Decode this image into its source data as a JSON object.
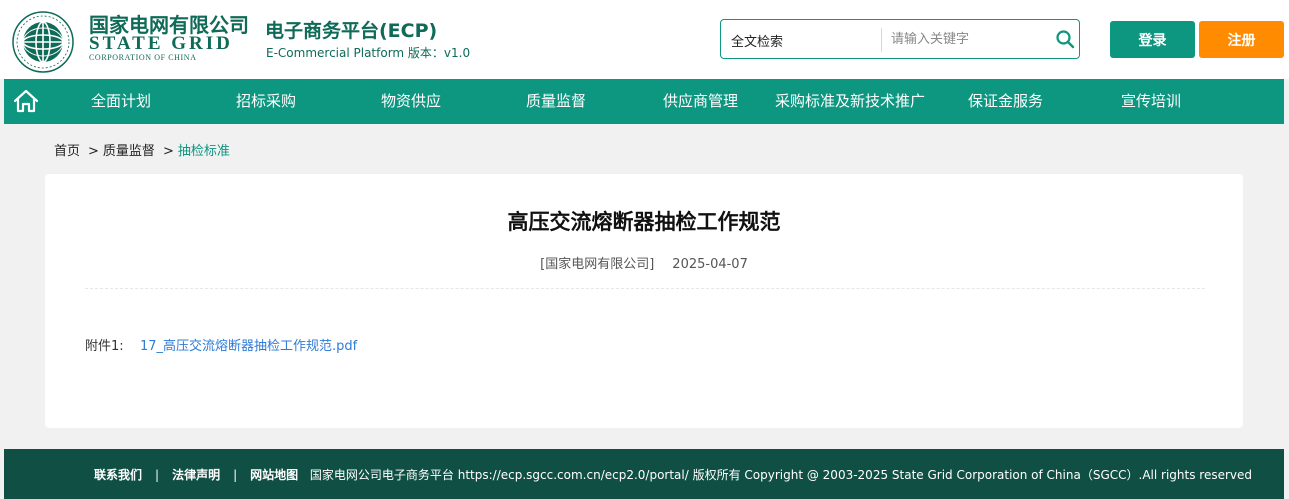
{
  "brand": {
    "cn_name": "国家电网有限公司",
    "en_name": "STATE GRID",
    "en_sub": "CORPORATION OF CHINA",
    "logo_icon": "state-grid-emblem"
  },
  "platform": {
    "title": "电子商务平台(ECP)",
    "subtitle": "E-Commercial Platform 版本：v1.0"
  },
  "search": {
    "type_label": "全文检索",
    "placeholder": "请输入关键字",
    "value": "",
    "icon": "search-icon"
  },
  "auth": {
    "login_label": "登录",
    "register_label": "注册"
  },
  "nav": {
    "home_icon": "home-icon",
    "items": [
      {
        "label": "全面计划"
      },
      {
        "label": "招标采购"
      },
      {
        "label": "物资供应"
      },
      {
        "label": "质量监督"
      },
      {
        "label": "供应商管理"
      },
      {
        "label": "采购标准及新技术推广"
      },
      {
        "label": "保证金服务"
      },
      {
        "label": "宣传培训"
      }
    ]
  },
  "breadcrumb": {
    "home": "首页",
    "sep": ">",
    "level1": "质量监督",
    "current": "抽检标准"
  },
  "article": {
    "title": "高压交流熔断器抽检工作规范",
    "source": "[国家电网有限公司]",
    "date": "2025-04-07",
    "attachment_label": "附件1:",
    "attachment_name": "17_高压交流熔断器抽检工作规范.pdf"
  },
  "footer": {
    "links": [
      "联系我们",
      "法律声明",
      "网站地图"
    ],
    "divider": "|",
    "copyright": "国家电网公司电子商务平台 https://ecp.sgcc.com.cn/ecp2.0/portal/ 版权所有 Copyright @ 2003-2025 State Grid Corporation of China（SGCC）.All rights reserved"
  },
  "colors": {
    "primary": "#0d9680",
    "brand_dark": "#0f6a58",
    "footer_bg": "#0f4f44",
    "register": "#ff8c00",
    "link": "#2f7bd6",
    "page_bg": "#f1f1f1"
  }
}
